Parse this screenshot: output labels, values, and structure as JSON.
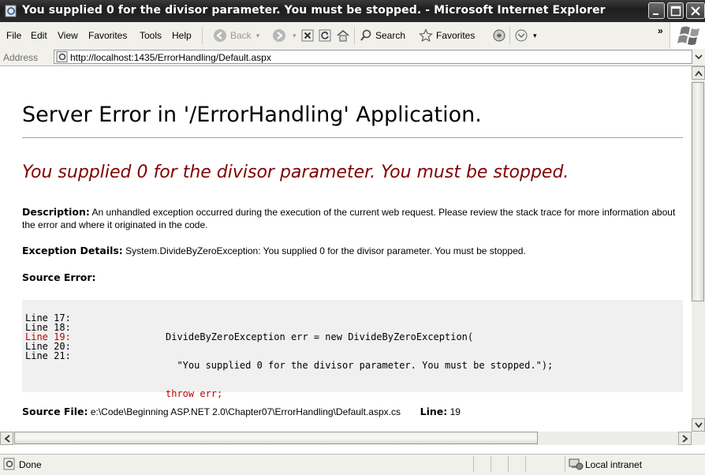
{
  "window": {
    "title": "You supplied 0 for the divisor parameter. You must be stopped. - Microsoft Internet Explorer"
  },
  "menu": {
    "items": [
      "File",
      "Edit",
      "View",
      "Favorites",
      "Tools",
      "Help"
    ]
  },
  "toolbar": {
    "back_label": "Back",
    "search_label": "Search",
    "favorites_label": "Favorites",
    "overflow_label": "»"
  },
  "address": {
    "label": "Address",
    "url": "http://localhost:1435/ErrorHandling/Default.aspx"
  },
  "page": {
    "title": "Server Error in '/ErrorHandling' Application.",
    "error_message": "You supplied 0 for the divisor parameter. You must be stopped.",
    "description_label": "Description:",
    "description_text": "An unhandled exception occurred during the execution of the current web request. Please review the stack trace for more information about the error and where it originated in the code.",
    "exception_label": "Exception Details:",
    "exception_text": "System.DivideByZeroException: You supplied 0 for the divisor parameter. You must be stopped.",
    "source_error_label": "Source Error:",
    "source_file_label": "Source File:",
    "source_file_path": "e:\\Code\\Beginning ASP.NET 2.0\\Chapter07\\ErrorHandling\\Default.aspx.cs",
    "line_label": "Line:",
    "line_value": "19"
  },
  "code": {
    "line_numbers": [
      "Line 17:",
      "Line 18:",
      "Line 19:",
      "Line 20:",
      "Line 21:"
    ],
    "lines": [
      "DivideByZeroException err = new DivideByZeroException(",
      "  \"You supplied 0 for the divisor parameter. You must be stopped.\");",
      "throw err;",
      "",
      ""
    ],
    "highlight_line_index": 2
  },
  "status": {
    "text": "Done",
    "zone": "Local intranet"
  },
  "colors": {
    "title_bar": "#2a2a2a",
    "error_message": "#800000",
    "highlight_line": "#c00000",
    "code_background": "#f0f0f0"
  }
}
